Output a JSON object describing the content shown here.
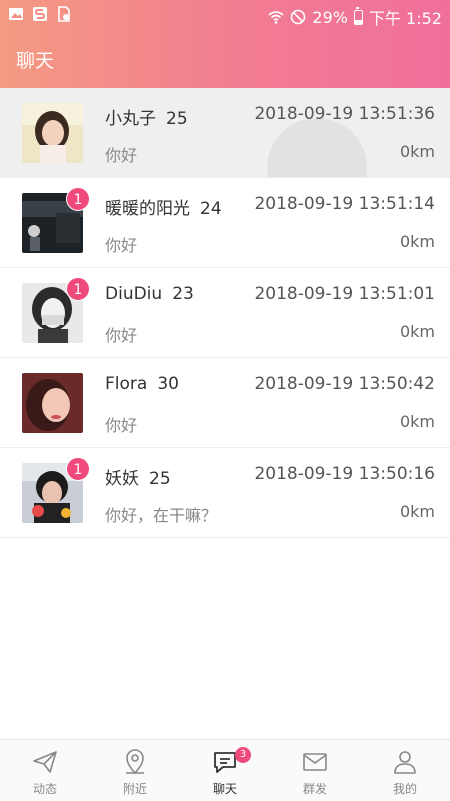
{
  "status_bar": {
    "battery": "29%",
    "time": "下午 1:52"
  },
  "header": {
    "title": "聊天"
  },
  "chats": [
    {
      "name": "小丸子",
      "age": "25",
      "time": "2018-09-19 13:51:36",
      "message": "你好",
      "distance": "0km",
      "unread": ""
    },
    {
      "name": "暖暖的阳光",
      "age": "24",
      "time": "2018-09-19 13:51:14",
      "message": "你好",
      "distance": "0km",
      "unread": "1"
    },
    {
      "name": "DiuDiu",
      "age": "23",
      "time": "2018-09-19 13:51:01",
      "message": "你好",
      "distance": "0km",
      "unread": "1"
    },
    {
      "name": "Flora",
      "age": "30",
      "time": "2018-09-19 13:50:42",
      "message": "你好",
      "distance": "0km",
      "unread": ""
    },
    {
      "name": "妖妖",
      "age": "25",
      "time": "2018-09-19 13:50:16",
      "message": "你好，在干嘛？",
      "distance": "0km",
      "unread": "1"
    }
  ],
  "nav": {
    "items": [
      {
        "label": "动态",
        "icon": "paper-plane-icon"
      },
      {
        "label": "附近",
        "icon": "location-pin-icon"
      },
      {
        "label": "聊天",
        "icon": "chat-bubble-icon",
        "badge": "3"
      },
      {
        "label": "群发",
        "icon": "envelope-icon"
      },
      {
        "label": "我的",
        "icon": "person-icon"
      }
    ]
  },
  "colors": {
    "header_start": "#f49a82",
    "header_end": "#ef6f9b",
    "badge": "#f0497c"
  }
}
